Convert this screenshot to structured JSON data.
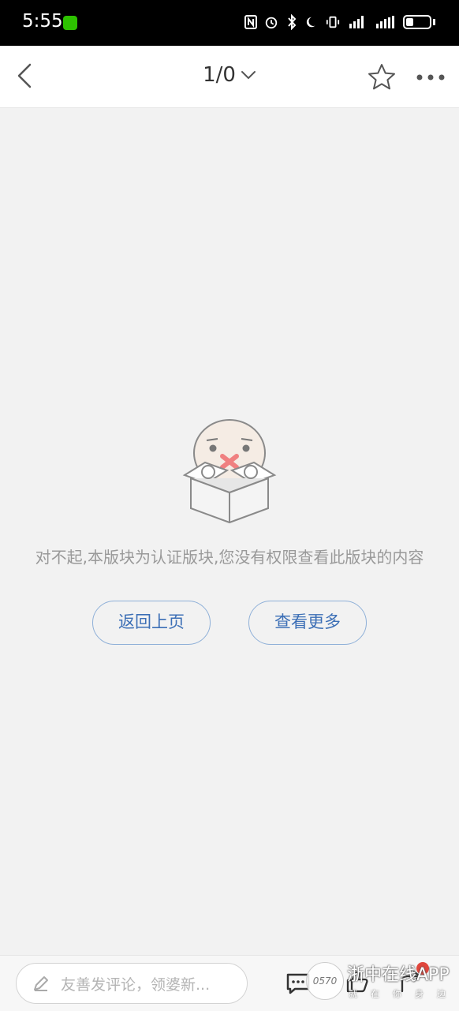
{
  "status": {
    "time": "5:55"
  },
  "topbar": {
    "page_indicator": "1/0"
  },
  "empty_state": {
    "message": "对不起,本版块为认证版块,您没有权限查看此版块的内容",
    "back_button": "返回上页",
    "more_button": "查看更多"
  },
  "bottombar": {
    "comment_placeholder": "友善发评论，领婆新..."
  },
  "watermark": {
    "logo": "0570",
    "title": "浙中在线APP",
    "subtitle": "就在你身边"
  },
  "colors": {
    "accent": "#3c6fb6",
    "button_border": "#8fb0d8",
    "background": "#f2f2f2"
  }
}
